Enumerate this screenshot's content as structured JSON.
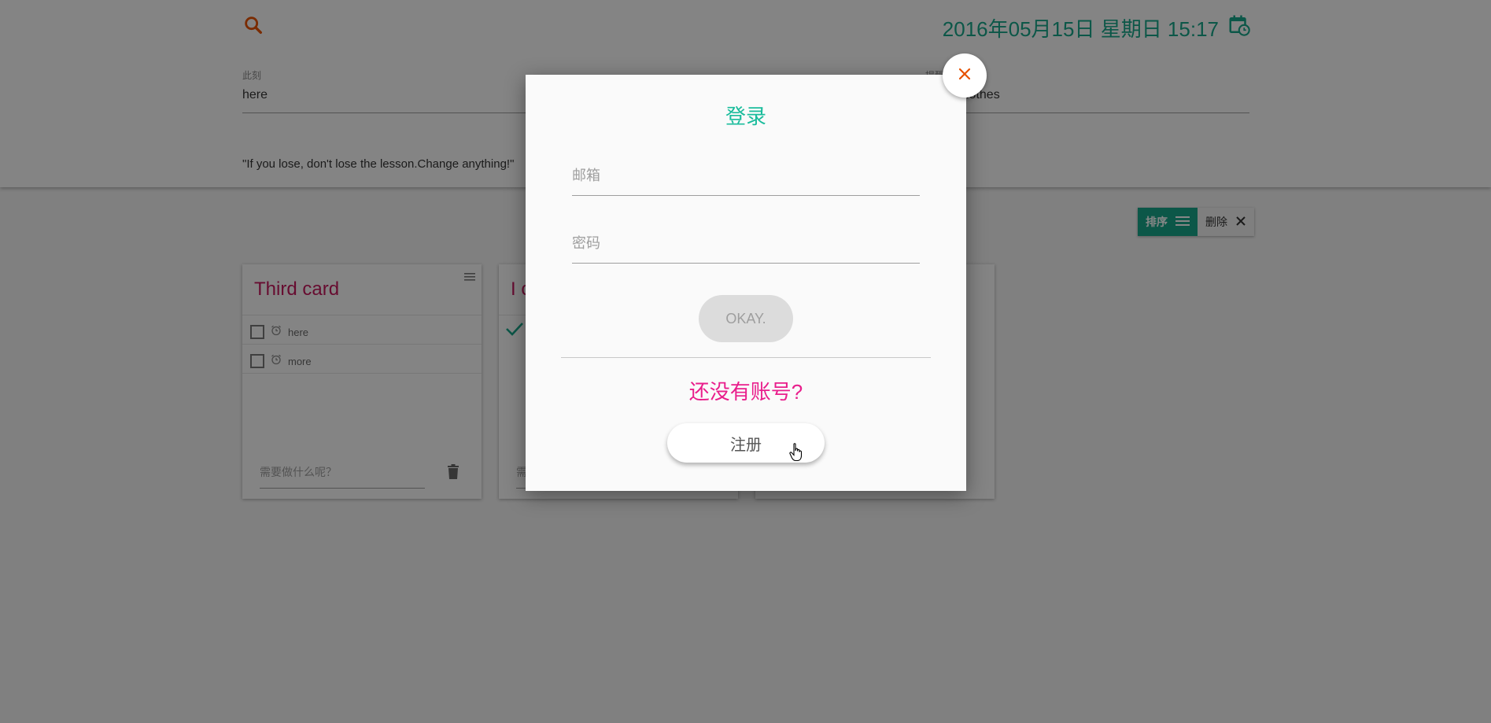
{
  "header": {
    "datetime": "2016年05月15日 星期日 15:17",
    "field_left_label": "此刻",
    "field_left_value": "here",
    "field_right_label": "提醒",
    "field_right_value": "clothes",
    "quote": "\"If you lose, don't lose the lesson.Change anything!\""
  },
  "toolbar": {
    "sort_label": "排序",
    "delete_label": "删除"
  },
  "cards": [
    {
      "title": "Third card",
      "items": [
        {
          "text": "here",
          "checked": false
        },
        {
          "text": "more",
          "checked": false
        }
      ],
      "new_placeholder": "需要做什么呢？"
    },
    {
      "title": "I c",
      "new_placeholder": "需"
    }
  ],
  "modal": {
    "title": "登录",
    "email_placeholder": "邮箱",
    "password_placeholder": "密码",
    "ok_label": "OKAY.",
    "no_account": "还没有账号?",
    "register_label": "注册"
  },
  "colors": {
    "accent": "#17a589",
    "pink": "#e91e8c",
    "close": "#e65100"
  },
  "icons": [
    "search-icon",
    "calendar-clock-icon",
    "menu-icon",
    "close-icon",
    "alarm-icon",
    "trash-icon",
    "check-icon",
    "hand-cursor-icon"
  ]
}
